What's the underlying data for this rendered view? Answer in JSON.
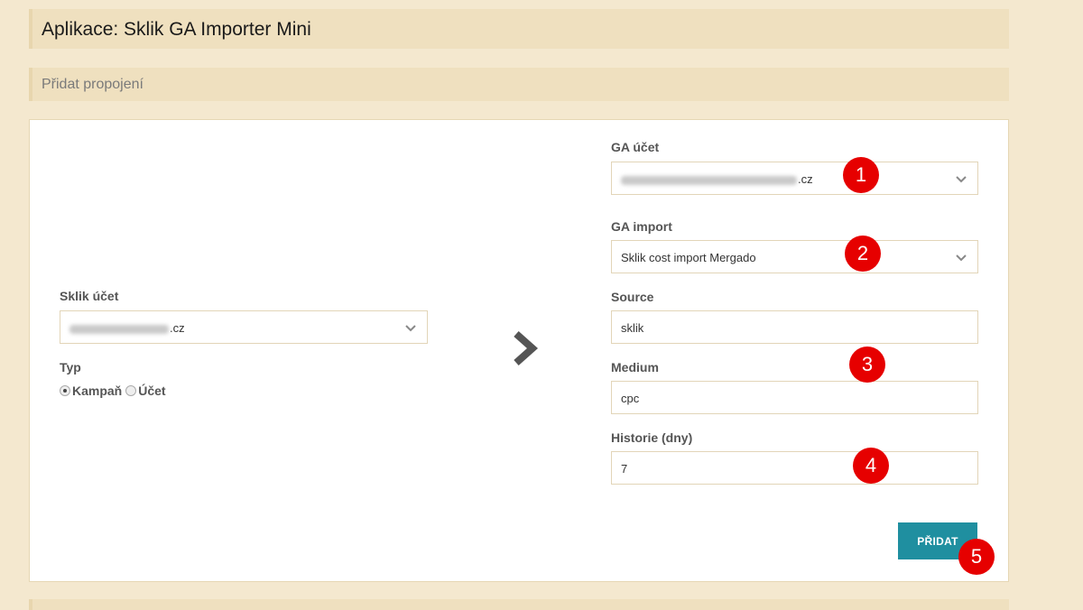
{
  "header": {
    "title": "Aplikace: Sklik GA Importer Mini"
  },
  "section": {
    "title": "Přidat propojení"
  },
  "left": {
    "sklik_label": "Sklik účet",
    "sklik_value_suffix": ".cz",
    "type_label": "Typ",
    "radio_options": [
      {
        "label": "Kampaň",
        "checked": true
      },
      {
        "label": "Účet",
        "checked": false
      }
    ]
  },
  "arrow_icon": "chevron-right-icon",
  "right": {
    "ga_account_label": "GA účet",
    "ga_account_value_suffix": ".cz",
    "ga_import_label": "GA import",
    "ga_import_value": "Sklik cost import Mergado",
    "source_label": "Source",
    "source_value": "sklik",
    "medium_label": "Medium",
    "medium_value": "cpc",
    "history_label": "Historie (dny)",
    "history_value": "7"
  },
  "submit_label": "PŘIDAT",
  "badges": [
    "1",
    "2",
    "3",
    "4",
    "5"
  ],
  "colors": {
    "background": "#f4e8cf",
    "bar": "#efe0bf",
    "button": "#1f8fa0",
    "badge": "#e60000"
  }
}
